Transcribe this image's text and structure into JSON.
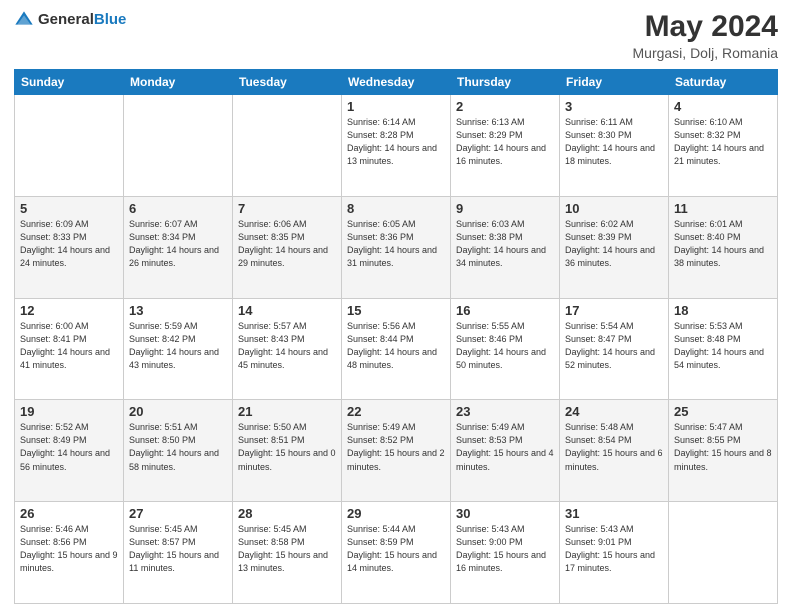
{
  "header": {
    "logo_general": "General",
    "logo_blue": "Blue",
    "month_year": "May 2024",
    "location": "Murgasi, Dolj, Romania"
  },
  "days_of_week": [
    "Sunday",
    "Monday",
    "Tuesday",
    "Wednesday",
    "Thursday",
    "Friday",
    "Saturday"
  ],
  "weeks": [
    [
      {
        "day": "",
        "sunrise": "",
        "sunset": "",
        "daylight": ""
      },
      {
        "day": "",
        "sunrise": "",
        "sunset": "",
        "daylight": ""
      },
      {
        "day": "",
        "sunrise": "",
        "sunset": "",
        "daylight": ""
      },
      {
        "day": "1",
        "sunrise": "Sunrise: 6:14 AM",
        "sunset": "Sunset: 8:28 PM",
        "daylight": "Daylight: 14 hours and 13 minutes."
      },
      {
        "day": "2",
        "sunrise": "Sunrise: 6:13 AM",
        "sunset": "Sunset: 8:29 PM",
        "daylight": "Daylight: 14 hours and 16 minutes."
      },
      {
        "day": "3",
        "sunrise": "Sunrise: 6:11 AM",
        "sunset": "Sunset: 8:30 PM",
        "daylight": "Daylight: 14 hours and 18 minutes."
      },
      {
        "day": "4",
        "sunrise": "Sunrise: 6:10 AM",
        "sunset": "Sunset: 8:32 PM",
        "daylight": "Daylight: 14 hours and 21 minutes."
      }
    ],
    [
      {
        "day": "5",
        "sunrise": "Sunrise: 6:09 AM",
        "sunset": "Sunset: 8:33 PM",
        "daylight": "Daylight: 14 hours and 24 minutes."
      },
      {
        "day": "6",
        "sunrise": "Sunrise: 6:07 AM",
        "sunset": "Sunset: 8:34 PM",
        "daylight": "Daylight: 14 hours and 26 minutes."
      },
      {
        "day": "7",
        "sunrise": "Sunrise: 6:06 AM",
        "sunset": "Sunset: 8:35 PM",
        "daylight": "Daylight: 14 hours and 29 minutes."
      },
      {
        "day": "8",
        "sunrise": "Sunrise: 6:05 AM",
        "sunset": "Sunset: 8:36 PM",
        "daylight": "Daylight: 14 hours and 31 minutes."
      },
      {
        "day": "9",
        "sunrise": "Sunrise: 6:03 AM",
        "sunset": "Sunset: 8:38 PM",
        "daylight": "Daylight: 14 hours and 34 minutes."
      },
      {
        "day": "10",
        "sunrise": "Sunrise: 6:02 AM",
        "sunset": "Sunset: 8:39 PM",
        "daylight": "Daylight: 14 hours and 36 minutes."
      },
      {
        "day": "11",
        "sunrise": "Sunrise: 6:01 AM",
        "sunset": "Sunset: 8:40 PM",
        "daylight": "Daylight: 14 hours and 38 minutes."
      }
    ],
    [
      {
        "day": "12",
        "sunrise": "Sunrise: 6:00 AM",
        "sunset": "Sunset: 8:41 PM",
        "daylight": "Daylight: 14 hours and 41 minutes."
      },
      {
        "day": "13",
        "sunrise": "Sunrise: 5:59 AM",
        "sunset": "Sunset: 8:42 PM",
        "daylight": "Daylight: 14 hours and 43 minutes."
      },
      {
        "day": "14",
        "sunrise": "Sunrise: 5:57 AM",
        "sunset": "Sunset: 8:43 PM",
        "daylight": "Daylight: 14 hours and 45 minutes."
      },
      {
        "day": "15",
        "sunrise": "Sunrise: 5:56 AM",
        "sunset": "Sunset: 8:44 PM",
        "daylight": "Daylight: 14 hours and 48 minutes."
      },
      {
        "day": "16",
        "sunrise": "Sunrise: 5:55 AM",
        "sunset": "Sunset: 8:46 PM",
        "daylight": "Daylight: 14 hours and 50 minutes."
      },
      {
        "day": "17",
        "sunrise": "Sunrise: 5:54 AM",
        "sunset": "Sunset: 8:47 PM",
        "daylight": "Daylight: 14 hours and 52 minutes."
      },
      {
        "day": "18",
        "sunrise": "Sunrise: 5:53 AM",
        "sunset": "Sunset: 8:48 PM",
        "daylight": "Daylight: 14 hours and 54 minutes."
      }
    ],
    [
      {
        "day": "19",
        "sunrise": "Sunrise: 5:52 AM",
        "sunset": "Sunset: 8:49 PM",
        "daylight": "Daylight: 14 hours and 56 minutes."
      },
      {
        "day": "20",
        "sunrise": "Sunrise: 5:51 AM",
        "sunset": "Sunset: 8:50 PM",
        "daylight": "Daylight: 14 hours and 58 minutes."
      },
      {
        "day": "21",
        "sunrise": "Sunrise: 5:50 AM",
        "sunset": "Sunset: 8:51 PM",
        "daylight": "Daylight: 15 hours and 0 minutes."
      },
      {
        "day": "22",
        "sunrise": "Sunrise: 5:49 AM",
        "sunset": "Sunset: 8:52 PM",
        "daylight": "Daylight: 15 hours and 2 minutes."
      },
      {
        "day": "23",
        "sunrise": "Sunrise: 5:49 AM",
        "sunset": "Sunset: 8:53 PM",
        "daylight": "Daylight: 15 hours and 4 minutes."
      },
      {
        "day": "24",
        "sunrise": "Sunrise: 5:48 AM",
        "sunset": "Sunset: 8:54 PM",
        "daylight": "Daylight: 15 hours and 6 minutes."
      },
      {
        "day": "25",
        "sunrise": "Sunrise: 5:47 AM",
        "sunset": "Sunset: 8:55 PM",
        "daylight": "Daylight: 15 hours and 8 minutes."
      }
    ],
    [
      {
        "day": "26",
        "sunrise": "Sunrise: 5:46 AM",
        "sunset": "Sunset: 8:56 PM",
        "daylight": "Daylight: 15 hours and 9 minutes."
      },
      {
        "day": "27",
        "sunrise": "Sunrise: 5:45 AM",
        "sunset": "Sunset: 8:57 PM",
        "daylight": "Daylight: 15 hours and 11 minutes."
      },
      {
        "day": "28",
        "sunrise": "Sunrise: 5:45 AM",
        "sunset": "Sunset: 8:58 PM",
        "daylight": "Daylight: 15 hours and 13 minutes."
      },
      {
        "day": "29",
        "sunrise": "Sunrise: 5:44 AM",
        "sunset": "Sunset: 8:59 PM",
        "daylight": "Daylight: 15 hours and 14 minutes."
      },
      {
        "day": "30",
        "sunrise": "Sunrise: 5:43 AM",
        "sunset": "Sunset: 9:00 PM",
        "daylight": "Daylight: 15 hours and 16 minutes."
      },
      {
        "day": "31",
        "sunrise": "Sunrise: 5:43 AM",
        "sunset": "Sunset: 9:01 PM",
        "daylight": "Daylight: 15 hours and 17 minutes."
      },
      {
        "day": "",
        "sunrise": "",
        "sunset": "",
        "daylight": ""
      }
    ]
  ]
}
